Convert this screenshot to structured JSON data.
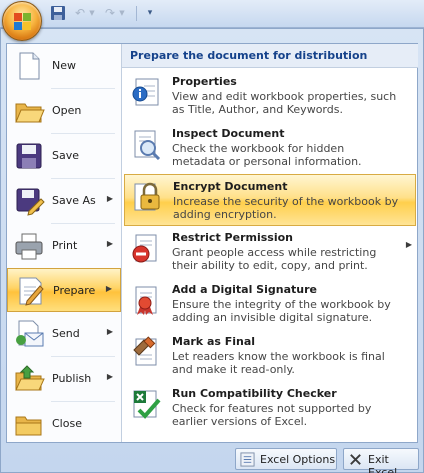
{
  "quick_access": {
    "save_icon": "save-icon",
    "undo_icon": "undo-icon",
    "redo_icon": "redo-icon",
    "customize_icon": "customize-qat-icon"
  },
  "left_menu": {
    "items": [
      {
        "label": "New",
        "icon": "new-document-icon",
        "has_submenu": false
      },
      {
        "label": "Open",
        "icon": "open-folder-icon",
        "has_submenu": false
      },
      {
        "label": "Save",
        "icon": "floppy-disk-icon",
        "has_submenu": false
      },
      {
        "label": "Save As",
        "icon": "save-as-icon",
        "has_submenu": true
      },
      {
        "label": "Print",
        "icon": "printer-icon",
        "has_submenu": true
      },
      {
        "label": "Prepare",
        "icon": "prepare-icon",
        "has_submenu": true,
        "active": true
      },
      {
        "label": "Send",
        "icon": "send-icon",
        "has_submenu": true
      },
      {
        "label": "Publish",
        "icon": "publish-icon",
        "has_submenu": true
      },
      {
        "label": "Close",
        "icon": "close-folder-icon",
        "has_submenu": false
      }
    ]
  },
  "prepare_panel": {
    "header": "Prepare the document for distribution",
    "commands": [
      {
        "title": "Properties",
        "description": "View and edit workbook properties, such as Title, Author, and Keywords.",
        "icon": "properties-icon"
      },
      {
        "title": "Inspect Document",
        "description": "Check the workbook for hidden metadata or personal information.",
        "icon": "inspect-icon"
      },
      {
        "title": "Encrypt Document",
        "description": "Increase the security of the workbook by adding encryption.",
        "icon": "lock-icon",
        "highlighted": true
      },
      {
        "title": "Restrict Permission",
        "description": "Grant people access while restricting their ability to edit, copy, and print.",
        "icon": "restrict-icon",
        "has_submenu": true
      },
      {
        "title": "Add a Digital Signature",
        "description": "Ensure the integrity of the workbook by adding an invisible digital signature.",
        "icon": "signature-ribbon-icon"
      },
      {
        "title": "Mark as Final",
        "description": "Let readers know the workbook is final and make it read-only.",
        "icon": "mark-final-icon"
      },
      {
        "title": "Run Compatibility Checker",
        "description": "Check for features not supported by earlier versions of Excel.",
        "icon": "compatibility-check-icon"
      }
    ]
  },
  "footer": {
    "options_label": "Excel Options",
    "exit_label": "Exit Excel"
  },
  "colors": {
    "highlight": "#ffd466",
    "header_text": "#15428b",
    "frame": "#c4d6ee"
  }
}
